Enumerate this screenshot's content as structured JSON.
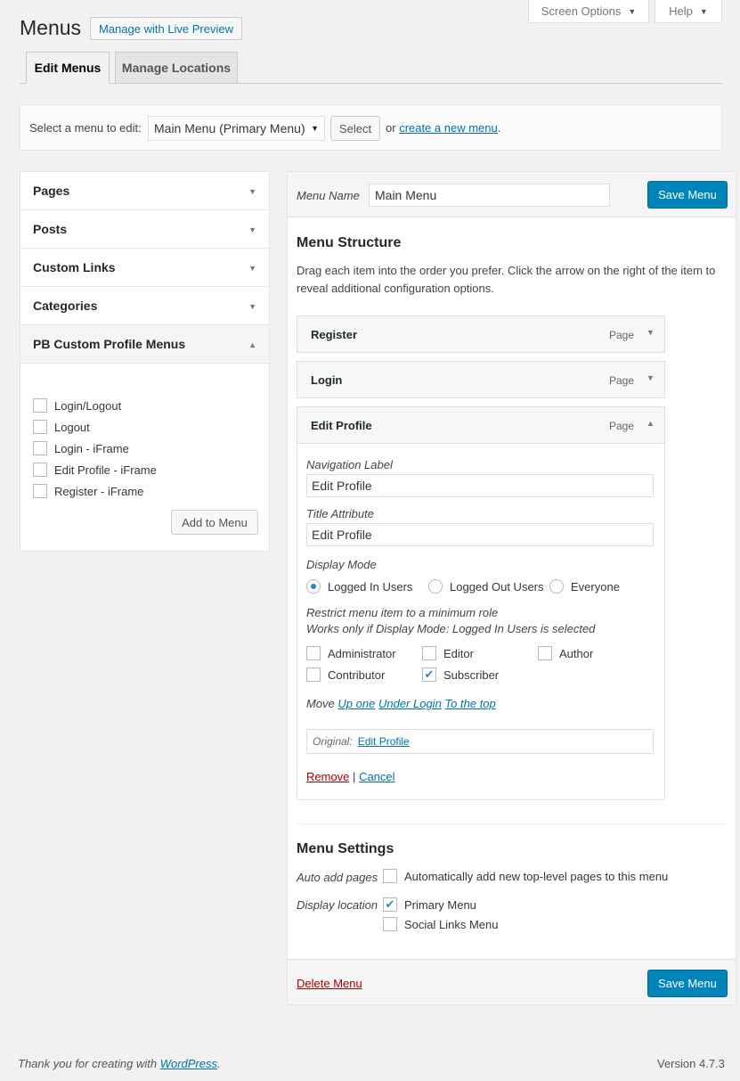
{
  "page": {
    "title": "Menus",
    "live_preview_label": "Manage with Live Preview"
  },
  "top_buttons": {
    "screen_options": "Screen Options",
    "help": "Help"
  },
  "tabs": [
    {
      "label": "Edit Menus",
      "active": true
    },
    {
      "label": "Manage Locations",
      "active": false
    }
  ],
  "menu_select": {
    "label": "Select a menu to edit:",
    "selected": "Main Menu (Primary Menu)",
    "select_button": "Select",
    "or_text": "or",
    "create_link": "create a new menu",
    "period": "."
  },
  "left_panel": {
    "sections": [
      "Pages",
      "Posts",
      "Custom Links",
      "Categories",
      "PB Custom Profile Menus"
    ],
    "items": [
      {
        "label": "Login/Logout",
        "checked": false
      },
      {
        "label": "Logout",
        "checked": false
      },
      {
        "label": "Login - iFrame",
        "checked": false
      },
      {
        "label": "Edit Profile - iFrame",
        "checked": false
      },
      {
        "label": "Register - iFrame",
        "checked": false
      }
    ],
    "add_button": "Add to Menu"
  },
  "editor": {
    "menu_name_label": "Menu Name",
    "menu_name_value": "Main Menu",
    "save_label": "Save Menu",
    "structure_title": "Menu Structure",
    "structure_desc": "Drag each item into the order you prefer. Click the arrow on the right of the item to reveal additional configuration options.",
    "items": [
      {
        "title": "Register",
        "type": "Page"
      },
      {
        "title": "Login",
        "type": "Page"
      },
      {
        "title": "Edit Profile",
        "type": "Page"
      }
    ],
    "settings": {
      "nav_label_label": "Navigation Label",
      "nav_label_value": "Edit Profile",
      "title_attr_label": "Title Attribute",
      "title_attr_value": "Edit Profile",
      "display_mode_label": "Display Mode",
      "display_modes": [
        {
          "label": "Logged In Users",
          "selected": true
        },
        {
          "label": "Logged Out Users",
          "selected": false
        },
        {
          "label": "Everyone",
          "selected": false
        }
      ],
      "restrict_line1": "Restrict menu item to a minimum role",
      "restrict_line2": "Works only if Display Mode: Logged In Users is selected",
      "roles": [
        {
          "label": "Administrator",
          "checked": false
        },
        {
          "label": "Editor",
          "checked": false
        },
        {
          "label": "Author",
          "checked": false
        },
        {
          "label": "Contributor",
          "checked": false
        },
        {
          "label": "Subscriber",
          "checked": true
        }
      ],
      "move_label": "Move",
      "move_links": [
        "Up one",
        "Under Login",
        "To the top"
      ],
      "original_label": "Original:",
      "original_link": "Edit Profile",
      "remove_label": "Remove",
      "separator": "|",
      "cancel_label": "Cancel"
    },
    "menu_settings": {
      "title": "Menu Settings",
      "auto_add_label": "Auto add pages",
      "auto_add_option": "Automatically add new top-level pages to this menu",
      "auto_add_checked": false,
      "display_location_label": "Display location",
      "locations": [
        {
          "label": "Primary Menu",
          "checked": true
        },
        {
          "label": "Social Links Menu",
          "checked": false
        }
      ]
    },
    "delete_label": "Delete Menu"
  },
  "footer": {
    "thanks": "Thank you for creating with",
    "wp_link": "WordPress",
    "period": ".",
    "version": "Version 4.7.3"
  }
}
